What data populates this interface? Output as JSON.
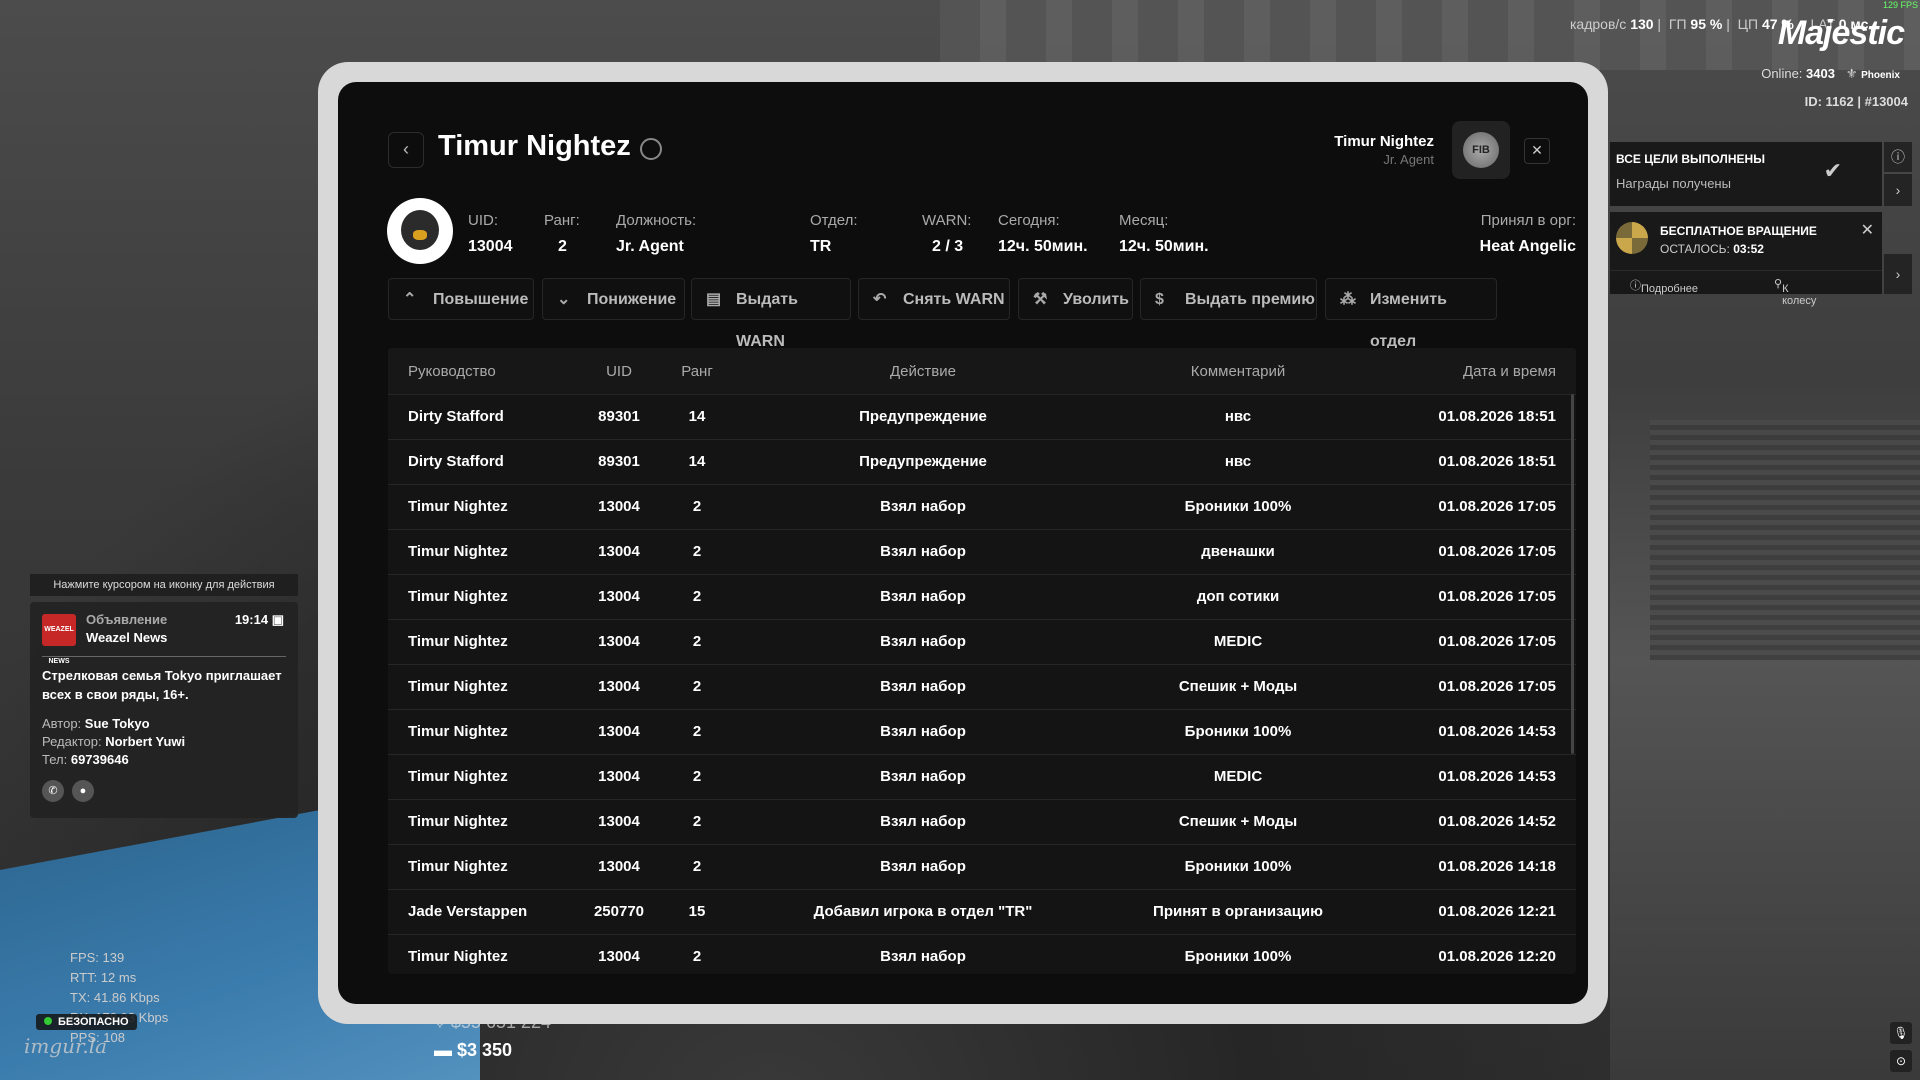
{
  "hud": {
    "fps_tiny": "129 FPS",
    "stats_parts": [
      "кадров/с",
      "130",
      "ГП",
      "95 %",
      "ЦП",
      "47 %",
      "• LAT",
      "0 мс"
    ],
    "brand": "Majestic",
    "online_label": "Online:",
    "online_value": "3403",
    "server": "Phoenix",
    "id_line": "ID: 1162 | #13004"
  },
  "goals": {
    "title": "ВСЕ ЦЕЛИ ВЫПОЛНЕНЫ",
    "subtitle": "Награды получены"
  },
  "spin": {
    "title": "БЕСПЛАТНОЕ ВРАЩЕНИЕ",
    "remaining_label": "ОСТАЛОСЬ:",
    "remaining_value": "03:52",
    "more_label": "Подробнее",
    "wheel_label": "К колесу"
  },
  "notification": {
    "hint": "Нажмите курсором на иконку для действия",
    "logo_text": "WEAZEL NEWS",
    "type": "Объявление",
    "source": "Weazel News",
    "time": "19:14",
    "body": "Стрелковая семья Tokyo приглашает всех в свои ряды, 16+.",
    "author_label": "Автор:",
    "author": "Sue Tokyo",
    "editor_label": "Редактор:",
    "editor": "Norbert Yuwi",
    "phone_label": "Тел:",
    "phone": "69739646"
  },
  "netstats": {
    "fps": "FPS:   139",
    "rtt": "RTT:   12 ms",
    "tx": "TX:    41.86 Kbps",
    "rx": "RX:    178.93 Kbps",
    "pps": "PPS:   108"
  },
  "safe_zone": "БЕЗОПАСНО",
  "watermark": "imgur.la",
  "money": {
    "cash": "$55 651 224",
    "bank": "$3 350"
  },
  "profile": {
    "name": "Timur Nightez",
    "me_name": "Timur Nightez",
    "me_rank": "Jr. Agent",
    "org_logo": "FIB",
    "fields": [
      {
        "label": "UID:",
        "value": "13004"
      },
      {
        "label": "Ранг:",
        "value": "2"
      },
      {
        "label": "Должность:",
        "value": "Jr. Agent"
      },
      {
        "label": "Отдел:",
        "value": "TR"
      },
      {
        "label": "WARN:",
        "value": "2 / 3"
      },
      {
        "label": "Сегодня:",
        "value": "12ч. 50мин."
      },
      {
        "label": "Месяц:",
        "value": "12ч. 50мин."
      },
      {
        "label": "Принял в орг:",
        "value": "Heat Angelic"
      }
    ]
  },
  "actions": [
    {
      "label": "Повышение",
      "icon": "arrow-up-icon"
    },
    {
      "label": "Понижение",
      "icon": "arrow-down-icon"
    },
    {
      "label": "Выдать WARN",
      "icon": "warn-icon"
    },
    {
      "label": "Снять WARN",
      "icon": "undo-icon"
    },
    {
      "label": "Уволить",
      "icon": "fire-icon"
    },
    {
      "label": "Выдать премию",
      "icon": "coin-icon"
    },
    {
      "label": "Изменить отдел",
      "icon": "org-icon"
    }
  ],
  "table": {
    "headers": [
      "Руководство",
      "UID",
      "Ранг",
      "Действие",
      "Комментарий",
      "Дата и время"
    ],
    "rows": [
      [
        "Dirty Stafford",
        "89301",
        "14",
        "Предупреждение",
        "нвс",
        "01.08.2026 18:51"
      ],
      [
        "Dirty Stafford",
        "89301",
        "14",
        "Предупреждение",
        "нвс",
        "01.08.2026 18:51"
      ],
      [
        "Timur Nightez",
        "13004",
        "2",
        "Взял набор",
        "Броники 100%",
        "01.08.2026 17:05"
      ],
      [
        "Timur Nightez",
        "13004",
        "2",
        "Взял набор",
        "двенашки",
        "01.08.2026 17:05"
      ],
      [
        "Timur Nightez",
        "13004",
        "2",
        "Взял набор",
        "доп сотики",
        "01.08.2026 17:05"
      ],
      [
        "Timur Nightez",
        "13004",
        "2",
        "Взял набор",
        "MEDIC",
        "01.08.2026 17:05"
      ],
      [
        "Timur Nightez",
        "13004",
        "2",
        "Взял набор",
        "Спешик + Моды",
        "01.08.2026 17:05"
      ],
      [
        "Timur Nightez",
        "13004",
        "2",
        "Взял набор",
        "Броники 100%",
        "01.08.2026 14:53"
      ],
      [
        "Timur Nightez",
        "13004",
        "2",
        "Взял набор",
        "MEDIC",
        "01.08.2026 14:53"
      ],
      [
        "Timur Nightez",
        "13004",
        "2",
        "Взял набор",
        "Спешик + Моды",
        "01.08.2026 14:52"
      ],
      [
        "Timur Nightez",
        "13004",
        "2",
        "Взял набор",
        "Броники 100%",
        "01.08.2026 14:18"
      ],
      [
        "Jade Verstappen",
        "250770",
        "15",
        "Добавил игрока в отдел \"TR\"",
        "Принят в организацию",
        "01.08.2026 12:21"
      ],
      [
        "Timur Nightez",
        "13004",
        "2",
        "Взял набор",
        "Броники 100%",
        "01.08.2026 12:20"
      ]
    ]
  }
}
